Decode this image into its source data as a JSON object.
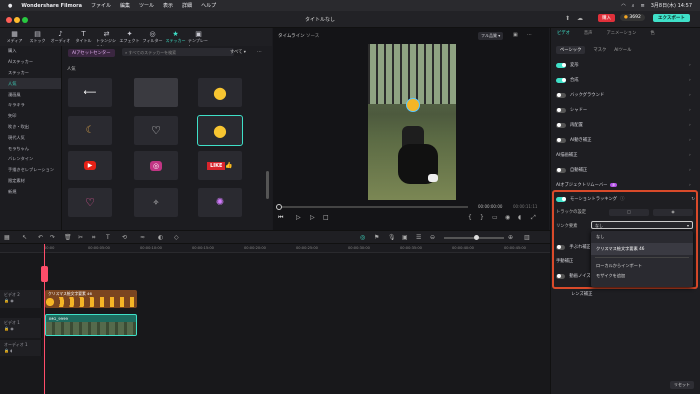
{
  "menubar": {
    "app": "Wondershare Filmora",
    "items": [
      "ファイル",
      "編集",
      "ツール",
      "表示",
      "詳細",
      "ヘルプ"
    ],
    "date": "3月8日(木) 14:57"
  },
  "titlebar": {
    "title": "タイトルなし",
    "buy_label": "購入",
    "credits": "3692",
    "export_label": "エクスポート"
  },
  "tooltabs": [
    {
      "icon": "▦",
      "label": "メディア"
    },
    {
      "icon": "▤",
      "label": "ストック"
    },
    {
      "icon": "♪",
      "label": "オーディオ"
    },
    {
      "icon": "T",
      "label": "タイトル"
    },
    {
      "icon": "⇄",
      "label": "トランジション"
    },
    {
      "icon": "✦",
      "label": "エフェクト"
    },
    {
      "icon": "◎",
      "label": "フィルター"
    },
    {
      "icon": "★",
      "label": "ステッカー"
    },
    {
      "icon": "▣",
      "label": "テンプレート"
    }
  ],
  "leftnav": [
    "購入",
    "AIステッカー",
    "ステッカー",
    "人気",
    "漫画風",
    "キラキラ",
    "矢印",
    "吹き・吹出",
    "現代人気",
    "モラちゃん",
    "バレンタイン",
    "手描きセレブレーション",
    "限定素材",
    "新規"
  ],
  "sticker_pane": {
    "ai_center": "AIアセットセンター",
    "search_placeholder": "すべてのステッカーを検索",
    "filter": "すべて",
    "section": "人気",
    "like_text": "LIKE"
  },
  "preview": {
    "tab_timeline": "タイムライン",
    "tab_source": "ソース",
    "quality": "フル品質",
    "time_current": "00:00:00:00",
    "time_total": "00:00:11:11"
  },
  "rightpanel": {
    "tabs": [
      "ビデオ",
      "音声",
      "アニメーション",
      "色"
    ],
    "subtabs": [
      "ベーシック",
      "マスク",
      "AIツール"
    ],
    "rows": [
      "変形",
      "合成",
      "バックグラウンド",
      "シャドー",
      "再配置",
      "AI動き補正",
      "AI描画補正",
      "自動補正",
      "AIオブジェクトリムーバー"
    ],
    "beta": "β",
    "motion_tracking": "モーショントラッキング",
    "track_settings": "トラックの設定",
    "link_element": "リンク要素",
    "link_value": "なし",
    "dropdown": [
      "なし",
      "クリスマス絵文字要素 46",
      "ローカルからインポート",
      "モザイクを追加"
    ],
    "hidden_rows": [
      "手ぶれ補正",
      "手動補正",
      "動画ノイズ除去",
      "レンズ補正"
    ],
    "reset": "リセット"
  },
  "timeline": {
    "ticks": [
      "00:00",
      "00:00:05:00",
      "00:00:10:00",
      "00:00:15:00",
      "00:00:20:00",
      "00:00:25:00",
      "00:00:30:00",
      "00:00:35:00",
      "00:00:40:00",
      "00:00:45:00"
    ],
    "tracks": [
      "ビデオ 2",
      "ビデオ 1",
      "オーディオ 1"
    ],
    "clip_sticker": "クリスマス絵文字要素 46",
    "clip_video": "IMG_9999"
  },
  "colors": {
    "accent": "#3fe0c8",
    "highlight": "#d94a2a",
    "export": "#3fe0c8",
    "buy": "#e0303a"
  }
}
